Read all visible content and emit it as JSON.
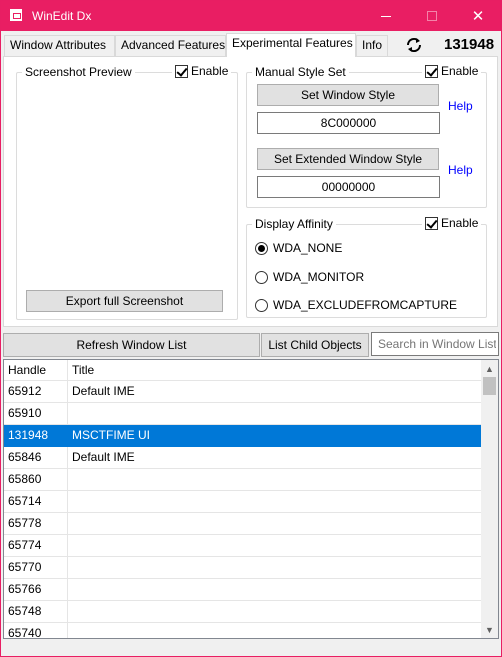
{
  "window": {
    "title": "WinEdit Dx"
  },
  "tabs": [
    {
      "label": "Window Attributes"
    },
    {
      "label": "Advanced Features"
    },
    {
      "label": "Experimental Features"
    },
    {
      "label": "Info"
    }
  ],
  "current_handle": "131948",
  "screenshot_preview": {
    "legend": "Screenshot Preview",
    "enable_label": "Enable",
    "enabled": true,
    "export_button": "Export full Screenshot"
  },
  "manual_style_set": {
    "legend": "Manual Style Set",
    "enable_label": "Enable",
    "enabled": true,
    "set_style_button": "Set Window Style",
    "style_value": "8C000000",
    "set_ex_style_button": "Set Extended Window Style",
    "ex_style_value": "00000000",
    "help_label": "Help"
  },
  "display_affinity": {
    "legend": "Display Affinity",
    "enable_label": "Enable",
    "enabled": true,
    "options": [
      {
        "label": "WDA_NONE",
        "selected": true
      },
      {
        "label": "WDA_MONITOR",
        "selected": false
      },
      {
        "label": "WDA_EXCLUDEFROMCAPTURE",
        "selected": false
      }
    ]
  },
  "list_toolbar": {
    "refresh_button": "Refresh Window List",
    "child_button": "List Child Objects",
    "search_placeholder": "Search in Window List"
  },
  "window_list": {
    "columns": [
      "Handle",
      "Title"
    ],
    "rows": [
      {
        "handle": "65912",
        "title": "Default IME"
      },
      {
        "handle": "65910",
        "title": ""
      },
      {
        "handle": "131948",
        "title": "MSCTFIME UI",
        "selected": true
      },
      {
        "handle": "65846",
        "title": "Default IME"
      },
      {
        "handle": "65860",
        "title": ""
      },
      {
        "handle": "65714",
        "title": ""
      },
      {
        "handle": "65778",
        "title": ""
      },
      {
        "handle": "65774",
        "title": ""
      },
      {
        "handle": "65770",
        "title": ""
      },
      {
        "handle": "65766",
        "title": ""
      },
      {
        "handle": "65748",
        "title": ""
      },
      {
        "handle": "65740",
        "title": ""
      }
    ]
  }
}
